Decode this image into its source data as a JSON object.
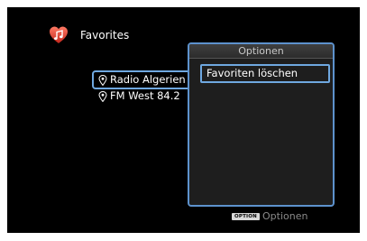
{
  "header": {
    "icon": "heart-music-note-icon",
    "title": "Favorites",
    "accent": "#e0463c"
  },
  "stations": [
    {
      "name": "Radio Algerien",
      "selected": true,
      "icon": "location-pin-icon"
    },
    {
      "name": "FM West 84.2",
      "selected": false,
      "icon": "location-pin-icon"
    }
  ],
  "options_popup": {
    "title": "Optionen",
    "items": [
      {
        "label": "Favoriten löschen",
        "selected": true
      }
    ],
    "border_color": "#5d92cd"
  },
  "footer_hint": {
    "key_label": "OPTION",
    "label": "Optionen"
  }
}
